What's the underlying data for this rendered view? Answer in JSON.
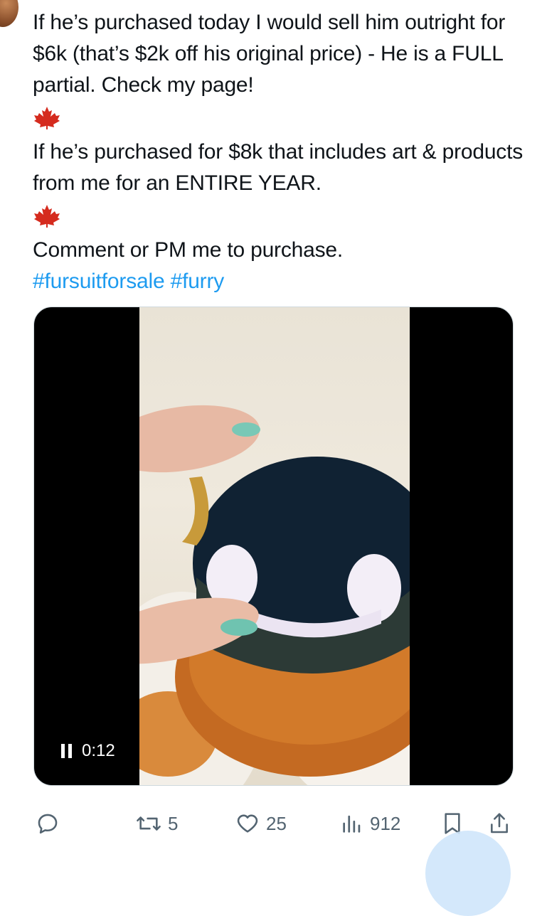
{
  "tweet": {
    "paragraph1": "If he’s purchased today I would sell him outright for $6k (that’s $2k off his original price) - He is a FULL partial. Check my page!",
    "paragraph2": "If he’s purchased for $8k that includes art & products from me for an ENTIRE YEAR.",
    "paragraph3": "Comment or PM me to purchase.",
    "hashtags": [
      "#fursuitforsale",
      "#furry"
    ],
    "separator_icon": "maple-leaf-icon",
    "accent_color": "#1d9bf0"
  },
  "video": {
    "time": "0:12",
    "state_icon": "pause-icon"
  },
  "actions": {
    "reply_icon": "reply-icon",
    "repost_count": "5",
    "like_count": "25",
    "views_count": "912",
    "bookmark_icon": "bookmark-icon",
    "share_icon": "share-icon"
  }
}
